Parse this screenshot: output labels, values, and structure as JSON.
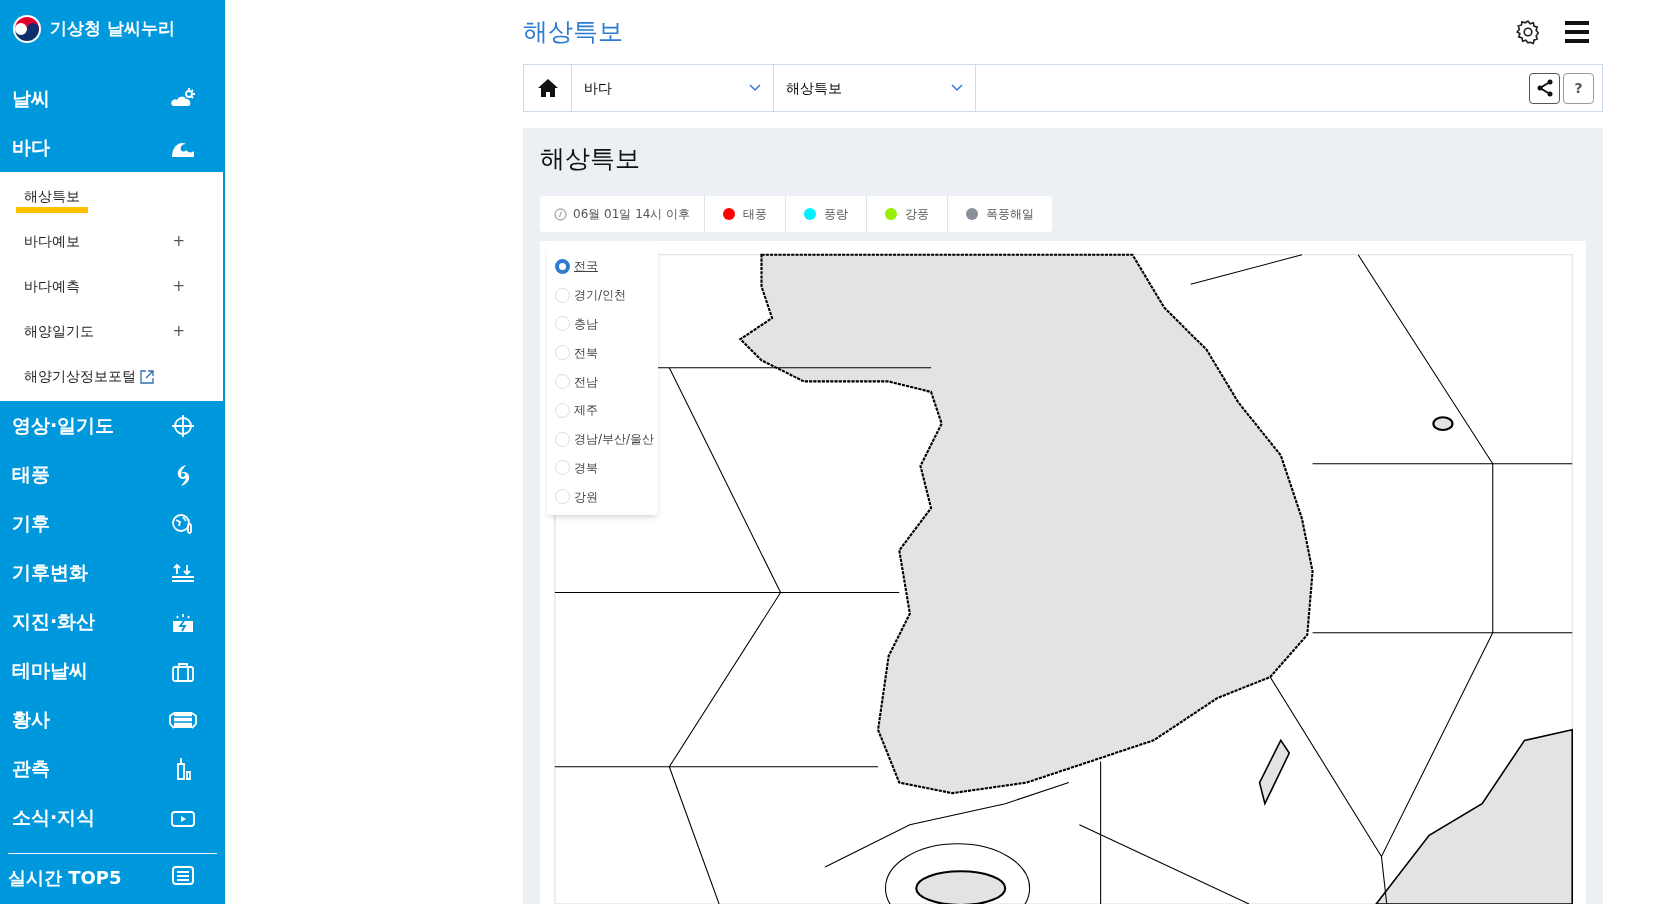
{
  "sidebar": {
    "logo_text": "기상청 날씨누리",
    "menu": [
      {
        "label": "날씨"
      },
      {
        "label": "바다",
        "expanded": true,
        "children": [
          {
            "label": "해상특보",
            "selected": true,
            "kind": "plain"
          },
          {
            "label": "바다예보",
            "selected": false,
            "kind": "expandable",
            "toggle": "+"
          },
          {
            "label": "바다예측",
            "selected": false,
            "kind": "expandable",
            "toggle": "+"
          },
          {
            "label": "해양일기도",
            "selected": false,
            "kind": "expandable",
            "toggle": "+"
          },
          {
            "label": "해양기상정보포털",
            "selected": false,
            "kind": "external"
          }
        ]
      },
      {
        "label": "영상·일기도"
      },
      {
        "label": "태풍"
      },
      {
        "label": "기후"
      },
      {
        "label": "기후변화"
      },
      {
        "label": "지진·화산"
      },
      {
        "label": "테마날씨"
      },
      {
        "label": "황사"
      },
      {
        "label": "관측"
      },
      {
        "label": "소식·지식"
      }
    ],
    "top5": {
      "label": "실시간 TOP5"
    }
  },
  "page_title": "해상특보",
  "breadcrumb": {
    "level_1": "바다",
    "level_2": "해상특보",
    "help": "?"
  },
  "panel": {
    "title": "해상특보",
    "legend": {
      "time": "06월 01일 14시 이후",
      "items": [
        {
          "label": "태풍",
          "color": "#ff0000"
        },
        {
          "label": "풍랑",
          "color": "#00f0ff"
        },
        {
          "label": "강풍",
          "color": "#99ee00"
        },
        {
          "label": "폭풍해일",
          "color": "#8a9099"
        }
      ]
    },
    "regions": [
      {
        "label": "전국",
        "selected": true
      },
      {
        "label": "경기/인천",
        "selected": false
      },
      {
        "label": "충남",
        "selected": false
      },
      {
        "label": "전북",
        "selected": false
      },
      {
        "label": "전남",
        "selected": false
      },
      {
        "label": "제주",
        "selected": false
      },
      {
        "label": "경남/부산/울산",
        "selected": false
      },
      {
        "label": "경북",
        "selected": false
      },
      {
        "label": "강원",
        "selected": false
      }
    ]
  }
}
